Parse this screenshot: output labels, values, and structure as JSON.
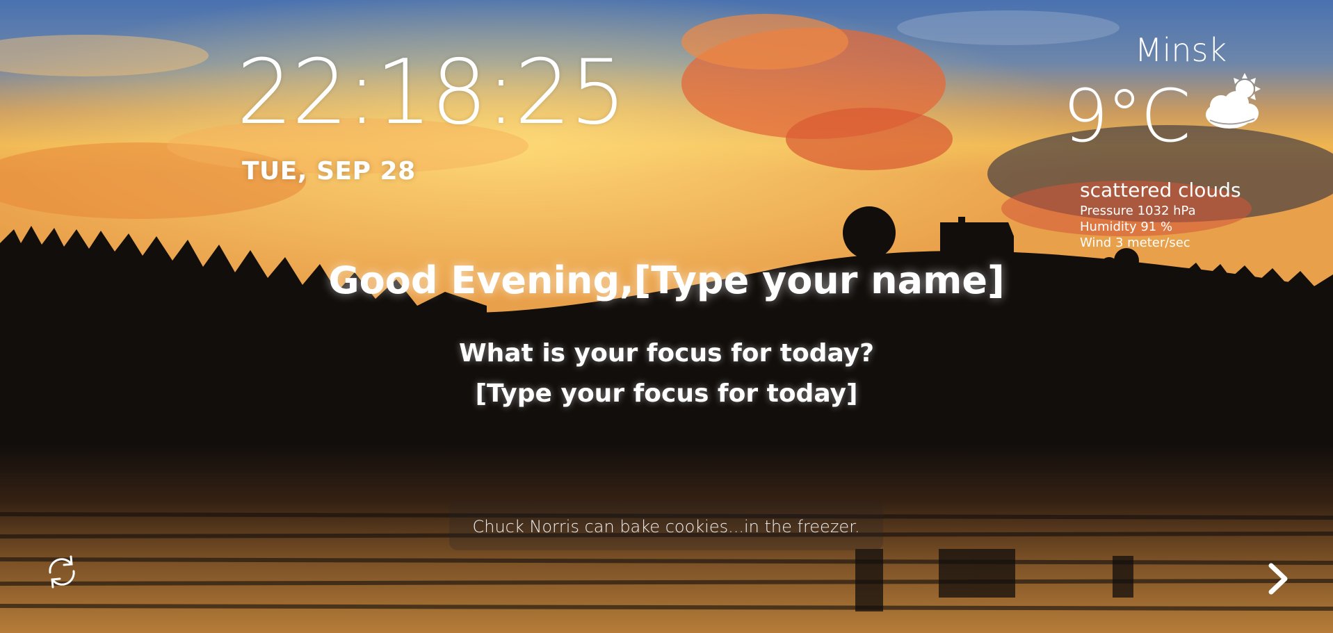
{
  "clock": {
    "time": "22:18:25",
    "date": "TUE, SEP 28"
  },
  "weather": {
    "city": "Minsk",
    "temperature": "9°C",
    "icon": "partly-cloudy-icon",
    "description": "scattered clouds",
    "pressure": "Pressure 1032 hPa",
    "humidity": "Humidity 91 %",
    "wind": "Wind 3 meter/sec"
  },
  "greeting": {
    "text": "Good Evening,",
    "name": "[Type your name]"
  },
  "focus": {
    "question": "What is your focus for today?",
    "value": "[Type your focus for today]"
  },
  "quote": {
    "text": "Chuck Norris can bake cookies...in the freezer."
  },
  "controls": {
    "refresh_icon": "refresh-icon",
    "next_icon": "chevron-right-icon"
  },
  "colors": {
    "sky_top": "#3f6fb0",
    "sunset_orange": "#f2a23c",
    "cloud_red": "#e0653a",
    "ground_dark": "#0f0c0b"
  }
}
